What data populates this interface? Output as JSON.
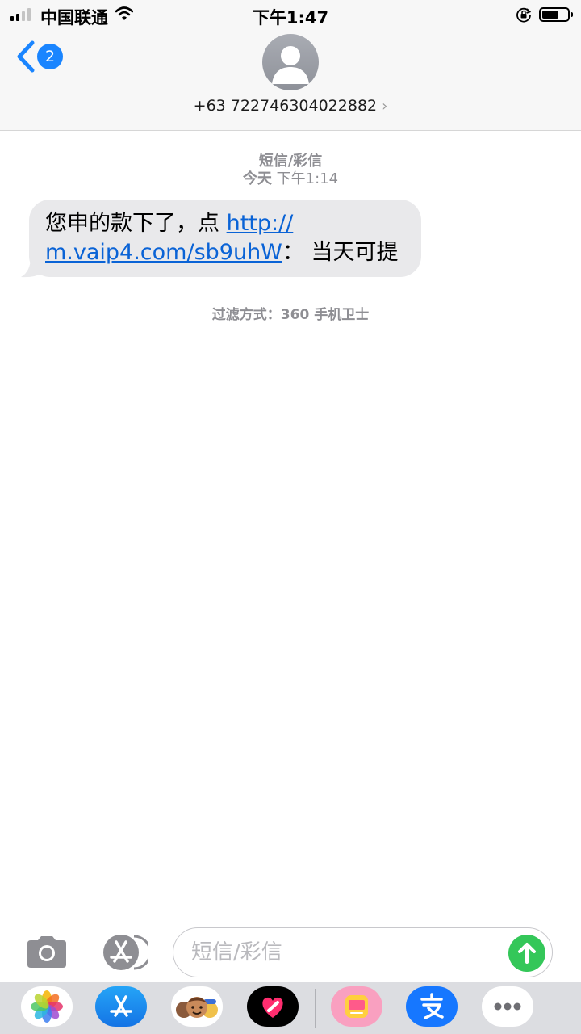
{
  "status_bar": {
    "carrier": "中国联通",
    "time": "下午1:47"
  },
  "header": {
    "back_badge_count": "2",
    "contact_number": "+63 722746304022882",
    "contact_chevron": "›"
  },
  "thread": {
    "service_label": "短信/彩信",
    "timestamp_day": "今天",
    "timestamp_time": "下午1:14",
    "filter_note": "过滤方式：360 手机卫士"
  },
  "message": {
    "text_before_link": "您申的款下了，点 ",
    "link_line1": "http://",
    "link_line2": "m.vaip4.com/sb9uhW",
    "text_after_link": "： 当天可提"
  },
  "composer": {
    "placeholder": "短信/彩信"
  },
  "colors": {
    "accent_blue": "#1a85ff",
    "link_blue": "#0a63d6",
    "send_green": "#34c759",
    "bubble_gray": "#e9e9eb"
  },
  "app_drawer": {
    "apps": [
      {
        "name": "photos-app-icon"
      },
      {
        "name": "app-store-icon"
      },
      {
        "name": "memoji-icon"
      },
      {
        "name": "digital-touch-icon"
      },
      {
        "name": "meitu-app-icon"
      },
      {
        "name": "alipay-icon"
      },
      {
        "name": "more-apps-icon"
      }
    ]
  }
}
